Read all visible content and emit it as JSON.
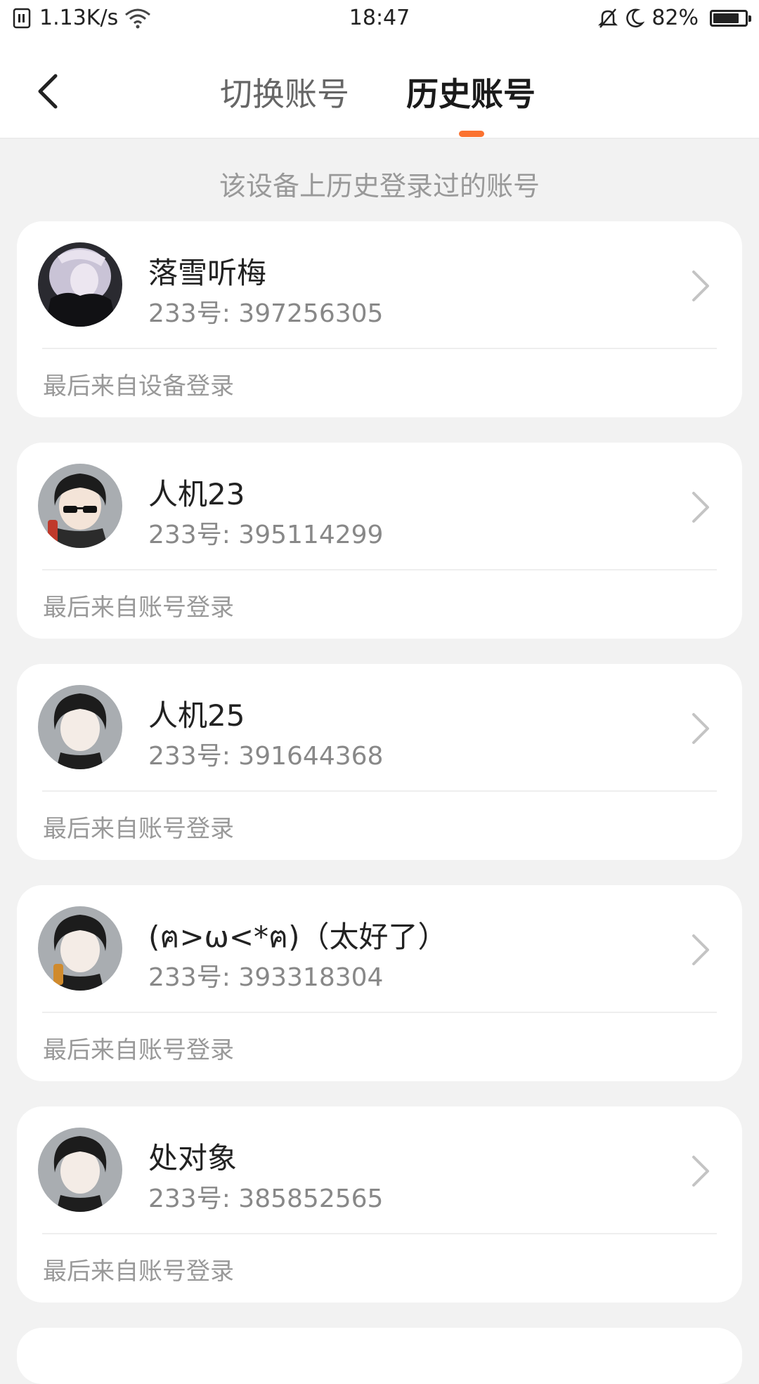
{
  "status_bar": {
    "net_speed": "1.13K/s",
    "time": "18:47",
    "battery": "82%",
    "battery_level": 0.82,
    "icons": [
      "sim-icon",
      "wifi-icon",
      "bell-muted-icon",
      "moon-icon",
      "battery-icon"
    ]
  },
  "header": {
    "tabs": [
      {
        "label": "切换账号",
        "active": false
      },
      {
        "label": "历史账号",
        "active": true
      }
    ],
    "accent_color": "#fb7230"
  },
  "subtitle": "该设备上历史登录过的账号",
  "accounts": [
    {
      "name": "落雪听梅",
      "id_label": "233号: ",
      "id": "397256305",
      "note": "最后来自设备登录",
      "avatar": "dark-hood-avatar"
    },
    {
      "name": "人机23",
      "id_label": "233号: ",
      "id": "395114299",
      "note": "最后来自账号登录",
      "avatar": "sunglasses-avatar"
    },
    {
      "name": "人机25",
      "id_label": "233号: ",
      "id": "391644368",
      "note": "最后来自账号登录",
      "avatar": "default-avatar"
    },
    {
      "name": "(ฅ>ω<*ฅ)（太好了）",
      "id_label": "233号: ",
      "id": "393318304",
      "note": "最后来自账号登录",
      "avatar": "default-avatar"
    },
    {
      "name": "处对象",
      "id_label": "233号: ",
      "id": "385852565",
      "note": "最后来自账号登录",
      "avatar": "default-avatar"
    }
  ]
}
